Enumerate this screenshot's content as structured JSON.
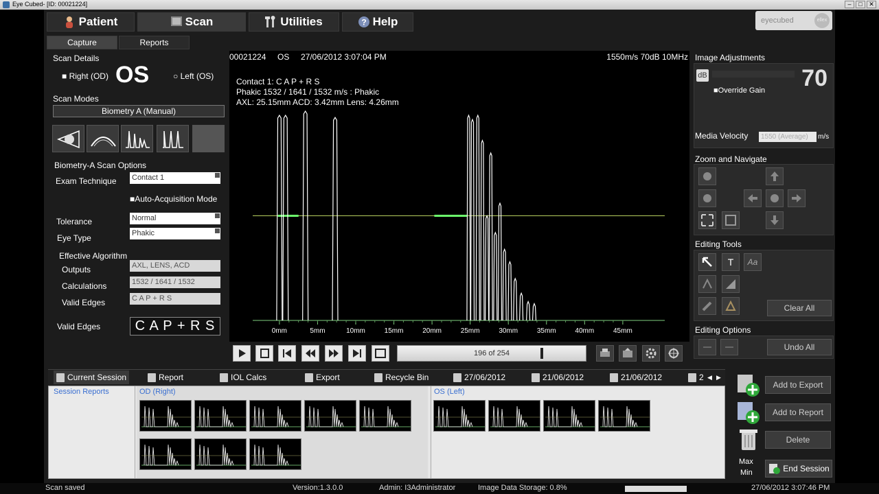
{
  "window": {
    "title": "Eye Cubed- [ID: 00021224]"
  },
  "nav": {
    "patient": "Patient",
    "scan": "Scan",
    "utilities": "Utilities",
    "help": "Help"
  },
  "logo": {
    "text": "eyecubed",
    "mark": "ellex"
  },
  "subtabs": {
    "capture": "Capture",
    "reports": "Reports"
  },
  "scan_details": {
    "heading": "Scan Details",
    "right": "Right (OD)",
    "eye": "OS",
    "left": "Left (OS)"
  },
  "scan_modes": {
    "heading": "Scan Modes",
    "selected": "Biometry A (Manual)"
  },
  "options": {
    "heading": "Biometry-A Scan Options",
    "exam_label": "Exam Technique",
    "exam_value": "Contact 1",
    "auto_label": "Auto-Acquisition Mode",
    "tolerance_label": "Tolerance",
    "tolerance_value": "Normal",
    "eyetype_label": "Eye Type",
    "eyetype_value": "Phakic",
    "algo_heading": "Effective Algorithm",
    "outputs_label": "Outputs",
    "outputs_value": "AXL, LENS, ACD",
    "calc_label": "Calculations",
    "calc_value": "1532 / 1641 / 1532",
    "edges_label": "Valid Edges",
    "edges_value": "C A P + R S",
    "edges2_label": "Valid Edges",
    "edges2_value": "C A P + R S"
  },
  "scan_header": {
    "id": "00021224",
    "eye": "OS",
    "datetime": "27/06/2012 3:07:04 PM",
    "params": "1550m/s  70dB 10MHz"
  },
  "scan_info": {
    "line1": "Contact 1: C A P + R S",
    "line2": "Phakic 1532 / 1641 / 1532 m/s : Phakic",
    "line3": "AXL: 25.15mm   ACD: 3.42mm   Lens: 4.26mm"
  },
  "chart_data": {
    "type": "line",
    "xlabel": "",
    "ylabel": "",
    "xlim": [
      -3.5,
      50.5
    ],
    "x_ticks": [
      "0mm",
      "5mm",
      "10mm",
      "15mm",
      "20mm",
      "25mm",
      "30mm",
      "35mm",
      "40mm",
      "45mm"
    ],
    "tick_values": [
      0,
      5,
      10,
      15,
      20,
      25,
      30,
      35,
      40,
      45
    ],
    "peaks": [
      {
        "x": 0.0,
        "h": 0.98
      },
      {
        "x": 0.8,
        "h": 0.98
      },
      {
        "x": 3.4,
        "h": 1.0
      },
      {
        "x": 7.3,
        "h": 0.97
      },
      {
        "x": 24.8,
        "h": 0.98
      },
      {
        "x": 25.3,
        "h": 0.96
      },
      {
        "x": 26.0,
        "h": 0.98
      },
      {
        "x": 26.6,
        "h": 0.86
      },
      {
        "x": 27.2,
        "h": 0.5
      },
      {
        "x": 27.7,
        "h": 0.8
      },
      {
        "x": 28.3,
        "h": 0.42
      },
      {
        "x": 28.9,
        "h": 0.56
      },
      {
        "x": 29.5,
        "h": 0.34
      },
      {
        "x": 30.2,
        "h": 0.28
      },
      {
        "x": 30.9,
        "h": 0.2
      },
      {
        "x": 31.7,
        "h": 0.13
      },
      {
        "x": 32.6,
        "h": 0.09
      },
      {
        "x": 33.4,
        "h": 0.08
      }
    ],
    "gate_line_level": 0.5
  },
  "player": {
    "counter": "196 of 254"
  },
  "image_adjustments": {
    "heading": "Image Adjustments",
    "db_label": "dB",
    "gain": "70",
    "override": "Override Gain",
    "velocity_label": "Media Velocity",
    "velocity_value": "1550 (Average)",
    "velocity_unit": "m/s"
  },
  "zoom": {
    "heading": "Zoom and Navigate"
  },
  "editing_tools": {
    "heading": "Editing Tools",
    "text_tool": "T",
    "font_tool": "Aa",
    "clear_all": "Clear All"
  },
  "editing_options": {
    "heading": "Editing Options",
    "undo_all": "Undo All"
  },
  "session_tabs": {
    "current": "Current Session",
    "report": "Report",
    "iol": "IOL Calcs",
    "export": "Export",
    "recycle": "Recycle Bin",
    "date1": "27/06/2012",
    "date2": "21/06/2012",
    "date3": "21/06/2012",
    "more": "2"
  },
  "session": {
    "reports": "Session Reports",
    "od": "OD (Right)",
    "os": "OS (Left)"
  },
  "side_actions": {
    "add_export": "Add to Export",
    "add_report": "Add to Report",
    "delete": "Delete",
    "max": "Max",
    "min": "Min",
    "end_session": "End Session"
  },
  "status": {
    "message": "Scan saved",
    "version": "Version:1.3.0.0",
    "admin": "Admin: I3Administrator",
    "storage": "Image Data Storage: 0.8%",
    "datetime": "27/06/2012 3:07:46 PM"
  }
}
